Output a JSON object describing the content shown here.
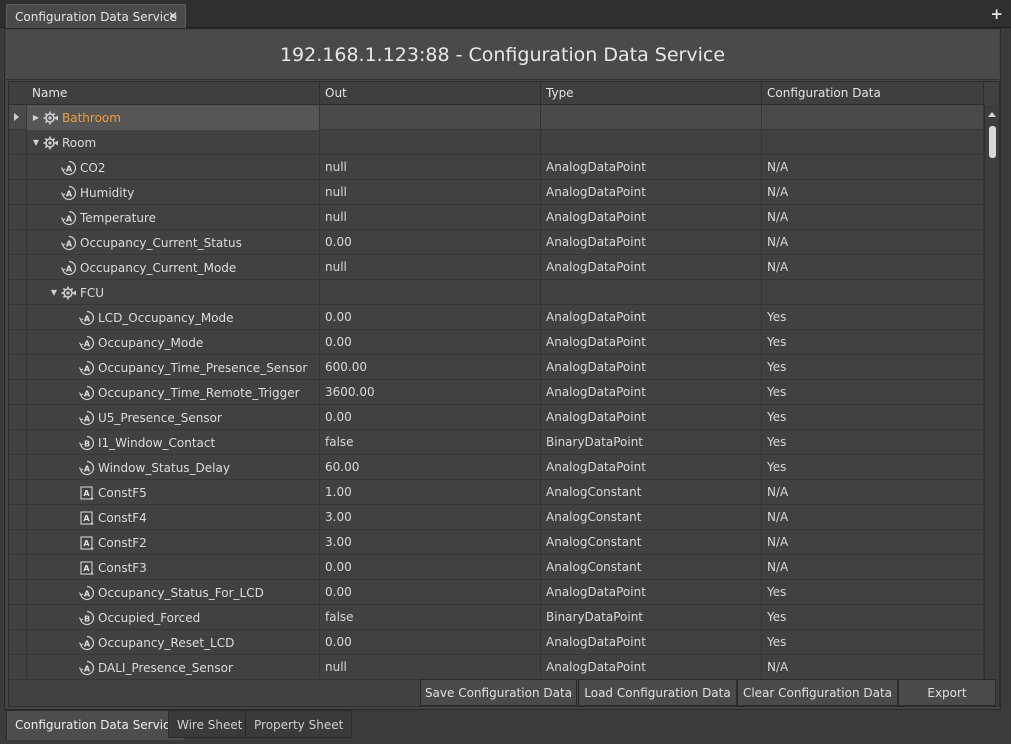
{
  "top_tab": {
    "label": "Configuration Data Service",
    "close_glyph": "✕"
  },
  "new_tab_glyph": "+",
  "title": "192.168.1.123:88 - Configuration Data Service",
  "columns": [
    "Name",
    "Out",
    "Type",
    "Configuration Data"
  ],
  "rows": [
    {
      "name": "Bathroom",
      "out": "",
      "type": "",
      "conf": "",
      "level": 0,
      "toggle": "collapsed",
      "icon": "gear-icon",
      "highlight": true,
      "selected": true,
      "gutter_arrow": true
    },
    {
      "name": "Room",
      "out": "",
      "type": "",
      "conf": "",
      "level": 0,
      "toggle": "expanded",
      "icon": "gear-icon"
    },
    {
      "name": "CO2",
      "out": "null",
      "type": "AnalogDataPoint",
      "conf": "N/A",
      "level": 1,
      "icon": "analog-point-icon"
    },
    {
      "name": "Humidity",
      "out": "null",
      "type": "AnalogDataPoint",
      "conf": "N/A",
      "level": 1,
      "icon": "analog-point-icon"
    },
    {
      "name": "Temperature",
      "out": "null",
      "type": "AnalogDataPoint",
      "conf": "N/A",
      "level": 1,
      "icon": "analog-point-icon"
    },
    {
      "name": "Occupancy_Current_Status",
      "out": "0.00",
      "type": "AnalogDataPoint",
      "conf": "N/A",
      "level": 1,
      "icon": "analog-point-icon"
    },
    {
      "name": "Occupancy_Current_Mode",
      "out": "null",
      "type": "AnalogDataPoint",
      "conf": "N/A",
      "level": 1,
      "icon": "analog-point-icon"
    },
    {
      "name": "FCU",
      "out": "",
      "type": "",
      "conf": "",
      "level": 1,
      "toggle": "expanded",
      "icon": "gear-icon"
    },
    {
      "name": "LCD_Occupancy_Mode",
      "out": "0.00",
      "type": "AnalogDataPoint",
      "conf": "Yes",
      "level": 2,
      "icon": "analog-point-icon"
    },
    {
      "name": "Occupancy_Mode",
      "out": "0.00",
      "type": "AnalogDataPoint",
      "conf": "Yes",
      "level": 2,
      "icon": "analog-point-icon"
    },
    {
      "name": "Occupancy_Time_Presence_Sensor",
      "out": "600.00",
      "type": "AnalogDataPoint",
      "conf": "Yes",
      "level": 2,
      "icon": "analog-point-icon"
    },
    {
      "name": "Occupancy_Time_Remote_Trigger",
      "out": "3600.00",
      "type": "AnalogDataPoint",
      "conf": "Yes",
      "level": 2,
      "icon": "analog-point-icon"
    },
    {
      "name": "U5_Presence_Sensor",
      "out": "0.00",
      "type": "AnalogDataPoint",
      "conf": "Yes",
      "level": 2,
      "icon": "analog-point-icon"
    },
    {
      "name": "I1_Window_Contact",
      "out": "false",
      "type": "BinaryDataPoint",
      "conf": "Yes",
      "level": 2,
      "icon": "binary-point-icon"
    },
    {
      "name": "Window_Status_Delay",
      "out": "60.00",
      "type": "AnalogDataPoint",
      "conf": "Yes",
      "level": 2,
      "icon": "analog-point-icon"
    },
    {
      "name": "ConstF5",
      "out": "1.00",
      "type": "AnalogConstant",
      "conf": "N/A",
      "level": 2,
      "icon": "analog-constant-icon"
    },
    {
      "name": "ConstF4",
      "out": "3.00",
      "type": "AnalogConstant",
      "conf": "N/A",
      "level": 2,
      "icon": "analog-constant-icon"
    },
    {
      "name": "ConstF2",
      "out": "3.00",
      "type": "AnalogConstant",
      "conf": "N/A",
      "level": 2,
      "icon": "analog-constant-icon"
    },
    {
      "name": "ConstF3",
      "out": "0.00",
      "type": "AnalogConstant",
      "conf": "N/A",
      "level": 2,
      "icon": "analog-constant-icon"
    },
    {
      "name": "Occupancy_Status_For_LCD",
      "out": "0.00",
      "type": "AnalogDataPoint",
      "conf": "Yes",
      "level": 2,
      "icon": "analog-point-icon"
    },
    {
      "name": "Occupied_Forced",
      "out": "false",
      "type": "BinaryDataPoint",
      "conf": "Yes",
      "level": 2,
      "icon": "binary-point-icon"
    },
    {
      "name": "Occupancy_Reset_LCD",
      "out": "0.00",
      "type": "AnalogDataPoint",
      "conf": "Yes",
      "level": 2,
      "icon": "analog-point-icon"
    },
    {
      "name": "DALI_Presence_Sensor",
      "out": "null",
      "type": "AnalogDataPoint",
      "conf": "N/A",
      "level": 2,
      "icon": "analog-point-icon"
    }
  ],
  "buttons": [
    "Save Configuration Data",
    "Load Configuration Data",
    "Clear Configuration Data",
    "Export"
  ],
  "bottom_tabs": [
    {
      "label": "Configuration Data Service",
      "active": true
    },
    {
      "label": "Wire Sheet",
      "active": false
    },
    {
      "label": "Property Sheet",
      "active": false
    }
  ],
  "colors": {
    "highlight_text": "#f0a030",
    "background": "#3b3b3b"
  }
}
